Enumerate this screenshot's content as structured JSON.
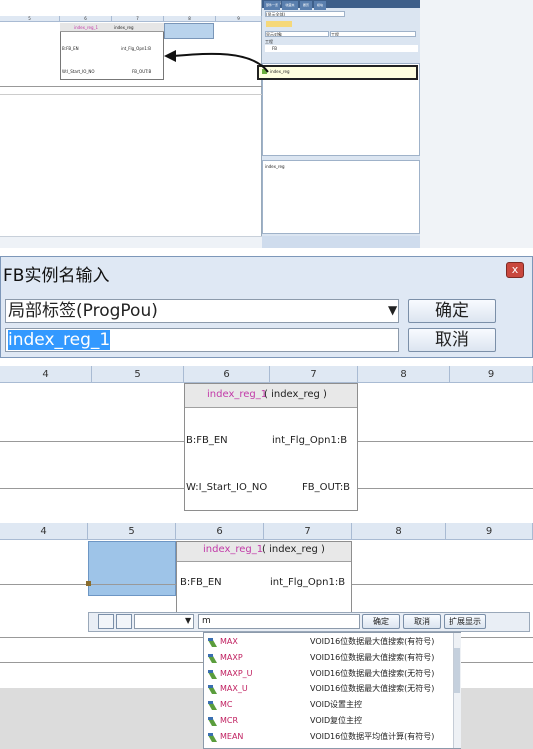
{
  "colors": {
    "accent": "#3399ff",
    "close": "#c9473d",
    "fb_header": "#e8e8e8",
    "selection": "#b9d3ec"
  },
  "panel1": {
    "ruler": [
      "5",
      "6",
      "7",
      "8",
      "9"
    ],
    "fb_instance": "index_reg_1",
    "fb_type": "index_reg",
    "in1": "B:FB_EN",
    "out1": "int_Flg_Opn1:B",
    "in2": "W:I_Start_IO_NO",
    "out2": "FB_OUT:B",
    "side_title": "部件选择",
    "side_search": "(显示全部)",
    "side_filter1": "显示对象",
    "side_filter2": "工程",
    "side_group": "工程",
    "side_sub": "FB",
    "side_item": "index_reg",
    "side_desc_title": "index_reg",
    "bottom_tabs": [
      "部件一览",
      "收藏夹",
      "履历",
      "模块"
    ]
  },
  "panel2": {
    "title": "FB实例名输入",
    "close": "x",
    "combo": "局部标签(ProgPou)",
    "combo_arrow": "▼",
    "input_value": "index_reg_1",
    "ok": "确定",
    "cancel": "取消"
  },
  "panel3": {
    "ruler": [
      "4",
      "5",
      "6",
      "7",
      "8",
      "9"
    ],
    "fb_instance": "index_reg_1",
    "fb_type": "( index_reg )",
    "in1": "B:FB_EN",
    "out1": "int_Flg_Opn1:B",
    "in2": "W:I_Start_IO_NO",
    "out2": "FB_OUT:B"
  },
  "panel4": {
    "ruler": [
      "4",
      "5",
      "6",
      "7",
      "8",
      "9"
    ],
    "fb_instance": "index_reg_1",
    "fb_type": "( index_reg )",
    "in1": "B:FB_EN",
    "out1": "int_Flg_Opn1:B",
    "input_value": "m",
    "ok": "确定",
    "cancel": "取消",
    "expand": "扩展显示",
    "items": [
      {
        "name": "MAX",
        "type": "VOID",
        "desc": "16位数据最大值搜索(有符号)"
      },
      {
        "name": "MAXP",
        "type": "VOID",
        "desc": "16位数据最大值搜索(有符号)"
      },
      {
        "name": "MAXP_U",
        "type": "VOID",
        "desc": "16位数据最大值搜索(无符号)"
      },
      {
        "name": "MAX_U",
        "type": "VOID",
        "desc": "16位数据最大值搜索(无符号)"
      },
      {
        "name": "MC",
        "type": "VOID",
        "desc": "设置主控"
      },
      {
        "name": "MCR",
        "type": "VOID",
        "desc": "复位主控"
      },
      {
        "name": "MEAN",
        "type": "VOID",
        "desc": "16位数据平均值计算(有符号)"
      }
    ]
  }
}
